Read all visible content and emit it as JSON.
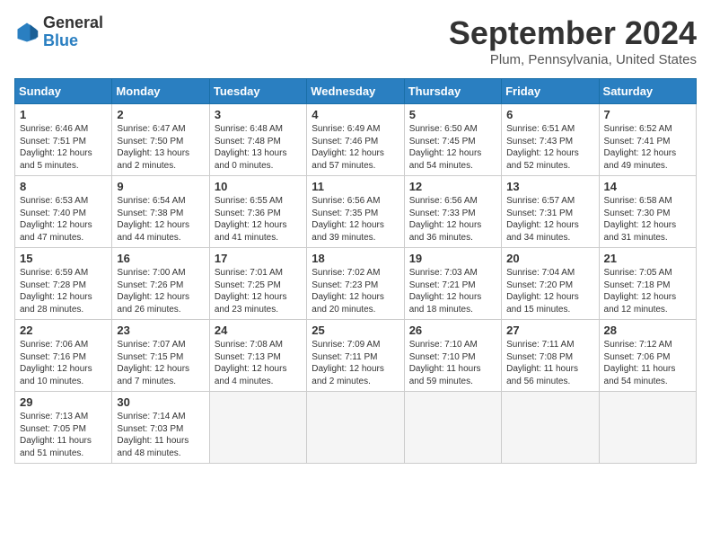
{
  "header": {
    "logo_general": "General",
    "logo_blue": "Blue",
    "month_title": "September 2024",
    "location": "Plum, Pennsylvania, United States"
  },
  "weekdays": [
    "Sunday",
    "Monday",
    "Tuesday",
    "Wednesday",
    "Thursday",
    "Friday",
    "Saturday"
  ],
  "weeks": [
    [
      {
        "day": "1",
        "sunrise": "6:46 AM",
        "sunset": "7:51 PM",
        "daylight": "12 hours and 5 minutes."
      },
      {
        "day": "2",
        "sunrise": "6:47 AM",
        "sunset": "7:50 PM",
        "daylight": "13 hours and 2 minutes."
      },
      {
        "day": "3",
        "sunrise": "6:48 AM",
        "sunset": "7:48 PM",
        "daylight": "13 hours and 0 minutes."
      },
      {
        "day": "4",
        "sunrise": "6:49 AM",
        "sunset": "7:46 PM",
        "daylight": "12 hours and 57 minutes."
      },
      {
        "day": "5",
        "sunrise": "6:50 AM",
        "sunset": "7:45 PM",
        "daylight": "12 hours and 54 minutes."
      },
      {
        "day": "6",
        "sunrise": "6:51 AM",
        "sunset": "7:43 PM",
        "daylight": "12 hours and 52 minutes."
      },
      {
        "day": "7",
        "sunrise": "6:52 AM",
        "sunset": "7:41 PM",
        "daylight": "12 hours and 49 minutes."
      }
    ],
    [
      {
        "day": "8",
        "sunrise": "6:53 AM",
        "sunset": "7:40 PM",
        "daylight": "12 hours and 47 minutes."
      },
      {
        "day": "9",
        "sunrise": "6:54 AM",
        "sunset": "7:38 PM",
        "daylight": "12 hours and 44 minutes."
      },
      {
        "day": "10",
        "sunrise": "6:55 AM",
        "sunset": "7:36 PM",
        "daylight": "12 hours and 41 minutes."
      },
      {
        "day": "11",
        "sunrise": "6:56 AM",
        "sunset": "7:35 PM",
        "daylight": "12 hours and 39 minutes."
      },
      {
        "day": "12",
        "sunrise": "6:56 AM",
        "sunset": "7:33 PM",
        "daylight": "12 hours and 36 minutes."
      },
      {
        "day": "13",
        "sunrise": "6:57 AM",
        "sunset": "7:31 PM",
        "daylight": "12 hours and 34 minutes."
      },
      {
        "day": "14",
        "sunrise": "6:58 AM",
        "sunset": "7:30 PM",
        "daylight": "12 hours and 31 minutes."
      }
    ],
    [
      {
        "day": "15",
        "sunrise": "6:59 AM",
        "sunset": "7:28 PM",
        "daylight": "12 hours and 28 minutes."
      },
      {
        "day": "16",
        "sunrise": "7:00 AM",
        "sunset": "7:26 PM",
        "daylight": "12 hours and 26 minutes."
      },
      {
        "day": "17",
        "sunrise": "7:01 AM",
        "sunset": "7:25 PM",
        "daylight": "12 hours and 23 minutes."
      },
      {
        "day": "18",
        "sunrise": "7:02 AM",
        "sunset": "7:23 PM",
        "daylight": "12 hours and 20 minutes."
      },
      {
        "day": "19",
        "sunrise": "7:03 AM",
        "sunset": "7:21 PM",
        "daylight": "12 hours and 18 minutes."
      },
      {
        "day": "20",
        "sunrise": "7:04 AM",
        "sunset": "7:20 PM",
        "daylight": "12 hours and 15 minutes."
      },
      {
        "day": "21",
        "sunrise": "7:05 AM",
        "sunset": "7:18 PM",
        "daylight": "12 hours and 12 minutes."
      }
    ],
    [
      {
        "day": "22",
        "sunrise": "7:06 AM",
        "sunset": "7:16 PM",
        "daylight": "12 hours and 10 minutes."
      },
      {
        "day": "23",
        "sunrise": "7:07 AM",
        "sunset": "7:15 PM",
        "daylight": "12 hours and 7 minutes."
      },
      {
        "day": "24",
        "sunrise": "7:08 AM",
        "sunset": "7:13 PM",
        "daylight": "12 hours and 4 minutes."
      },
      {
        "day": "25",
        "sunrise": "7:09 AM",
        "sunset": "7:11 PM",
        "daylight": "12 hours and 2 minutes."
      },
      {
        "day": "26",
        "sunrise": "7:10 AM",
        "sunset": "7:10 PM",
        "daylight": "11 hours and 59 minutes."
      },
      {
        "day": "27",
        "sunrise": "7:11 AM",
        "sunset": "7:08 PM",
        "daylight": "11 hours and 56 minutes."
      },
      {
        "day": "28",
        "sunrise": "7:12 AM",
        "sunset": "7:06 PM",
        "daylight": "11 hours and 54 minutes."
      }
    ],
    [
      {
        "day": "29",
        "sunrise": "7:13 AM",
        "sunset": "7:05 PM",
        "daylight": "11 hours and 51 minutes."
      },
      {
        "day": "30",
        "sunrise": "7:14 AM",
        "sunset": "7:03 PM",
        "daylight": "11 hours and 48 minutes."
      },
      null,
      null,
      null,
      null,
      null
    ]
  ]
}
